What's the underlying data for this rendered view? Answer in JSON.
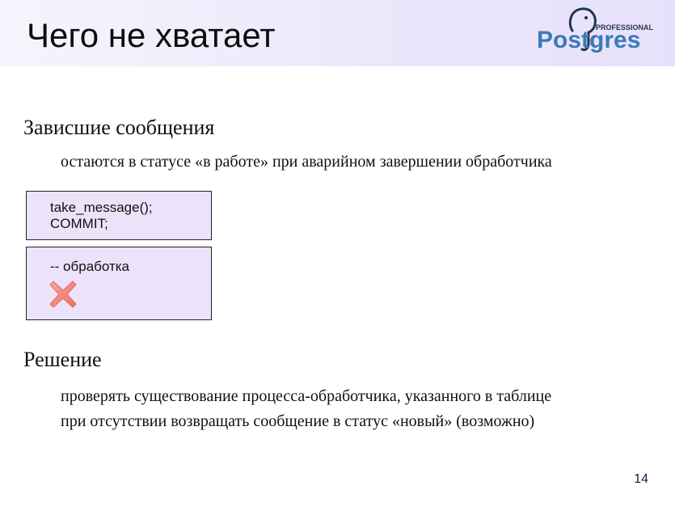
{
  "slide": {
    "title": "Чего не хватает",
    "page_number": "14"
  },
  "logo": {
    "top_text": "PROFESSIONAL",
    "brand_text": "Postgres",
    "brand_color": "#3a7ab8",
    "icon": "elephant-logo-icon"
  },
  "section1": {
    "heading": "Зависшие сообщения",
    "text": "остаются в статусе «в работе» при аварийном завершении обработчика"
  },
  "code_box1": {
    "lines": [
      "take_message();",
      "COMMIT;"
    ]
  },
  "code_box2": {
    "comment": "-- обработка",
    "icon": "cross-icon"
  },
  "section2": {
    "heading": "Решение",
    "lines": [
      "проверять существование процесса-обработчика, указанного в таблице",
      "при отсутствии возвращать сообщение в статус «новый» (возможно)"
    ]
  },
  "colors": {
    "header_bg": "#e6e1fa",
    "box_bg": "#ece3fb",
    "cross_fill": "#f4867a"
  }
}
